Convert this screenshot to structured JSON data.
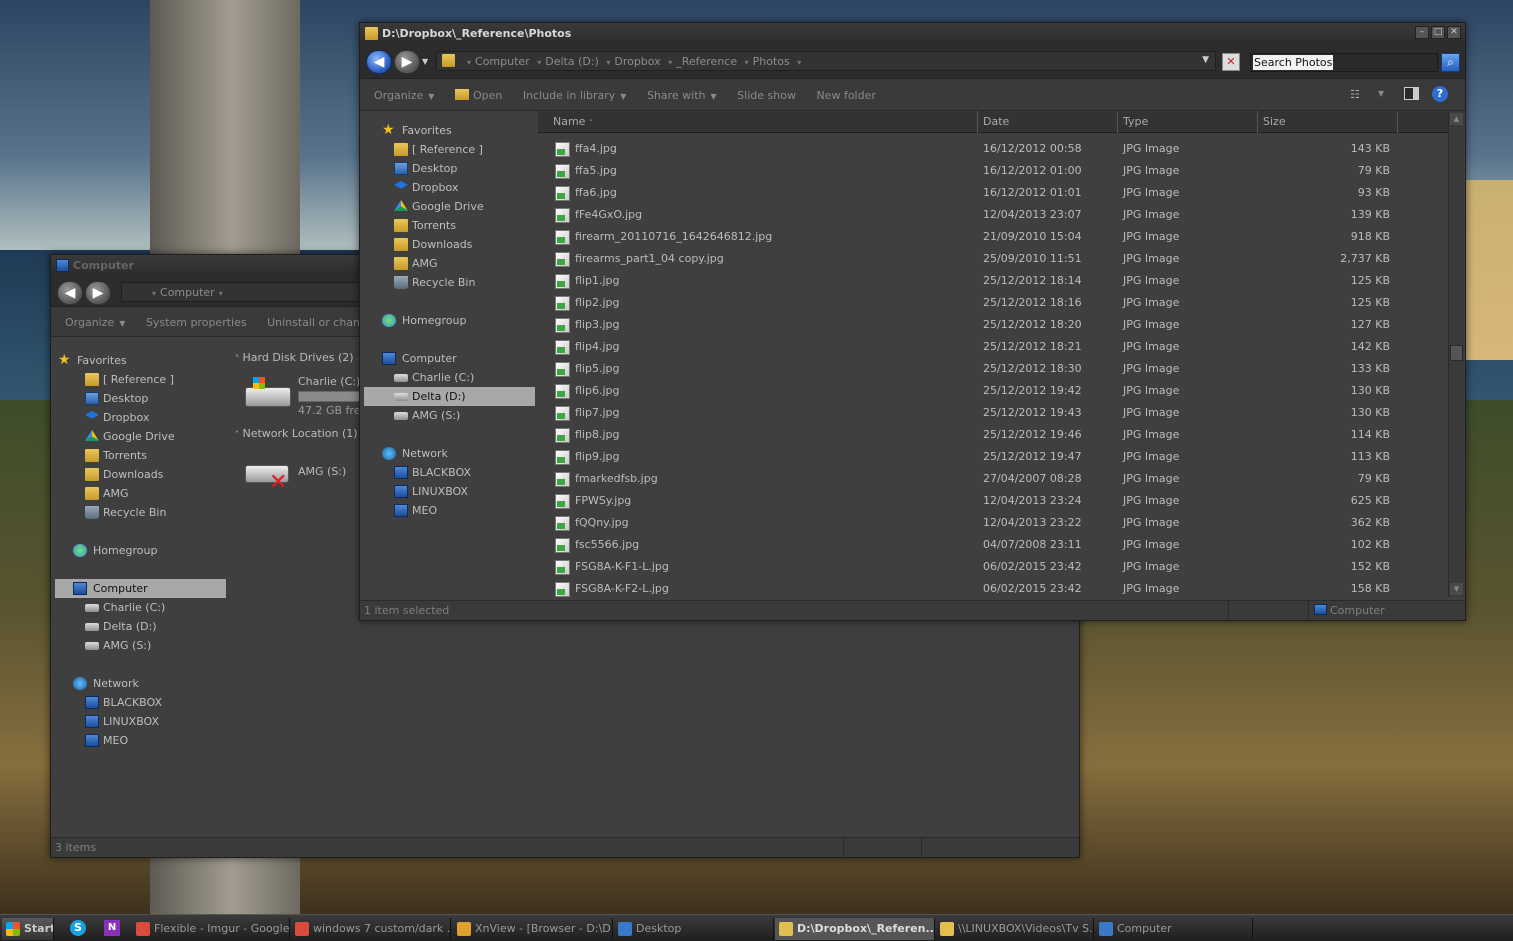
{
  "left_window": {
    "title": "Computer",
    "address": [
      "Computer"
    ],
    "toolbar": [
      "Organize",
      "System properties",
      "Uninstall or change a p"
    ],
    "nav": {
      "favorites": "Favorites",
      "fav_items": [
        "[ Reference ]",
        "Desktop",
        "Dropbox",
        "Google Drive",
        "Torrents",
        "Downloads",
        "AMG",
        "Recycle Bin"
      ],
      "homegroup": "Homegroup",
      "computer": "Computer",
      "drives": [
        "Charlie (C:)",
        "Delta (D:)",
        "AMG (S:)"
      ],
      "network": "Network",
      "net_items": [
        "BLACKBOX",
        "LINUXBOX",
        "MEO"
      ]
    },
    "groups": {
      "hdd": "Hard Disk Drives (2)",
      "netloc": "Network Location (1)"
    },
    "drive_charlie": {
      "name": "Charlie (C:)",
      "free": "47.2 GB free",
      "fill": 0.0
    },
    "drive_amg": {
      "name": "AMG (S:)"
    },
    "status": "3 items"
  },
  "right_window": {
    "title": "D:\\Dropbox\\_Reference\\Photos",
    "breadcrumb": [
      "Computer",
      "Delta (D:)",
      "Dropbox",
      "_Reference",
      "Photos"
    ],
    "search_placeholder": "Search Photos",
    "toolbar": {
      "organize": "Organize",
      "open": "Open",
      "include": "Include in library",
      "share": "Share with",
      "slideshow": "Slide show",
      "newfolder": "New folder"
    },
    "nav": {
      "favorites": "Favorites",
      "fav_items": [
        "[ Reference ]",
        "Desktop",
        "Dropbox",
        "Google Drive",
        "Torrents",
        "Downloads",
        "AMG",
        "Recycle Bin"
      ],
      "homegroup": "Homegroup",
      "computer": "Computer",
      "drives": [
        "Charlie (C:)",
        "Delta (D:)",
        "AMG (S:)"
      ],
      "network": "Network",
      "net_items": [
        "BLACKBOX",
        "LINUXBOX",
        "MEO"
      ]
    },
    "columns": [
      "Name",
      "Date",
      "Type",
      "Size"
    ],
    "files": [
      {
        "name": "ffa4.jpg",
        "date": "16/12/2012 00:58",
        "type": "JPG Image",
        "size": "143 KB"
      },
      {
        "name": "ffa5.jpg",
        "date": "16/12/2012 01:00",
        "type": "JPG Image",
        "size": "79 KB"
      },
      {
        "name": "ffa6.jpg",
        "date": "16/12/2012 01:01",
        "type": "JPG Image",
        "size": "93 KB"
      },
      {
        "name": "fFe4GxO.jpg",
        "date": "12/04/2013 23:07",
        "type": "JPG Image",
        "size": "139 KB"
      },
      {
        "name": "firearm_20110716_1642646812.jpg",
        "date": "21/09/2010 15:04",
        "type": "JPG Image",
        "size": "918 KB"
      },
      {
        "name": "firearms_part1_04 copy.jpg",
        "date": "25/09/2010 11:51",
        "type": "JPG Image",
        "size": "2,737 KB"
      },
      {
        "name": "flip1.jpg",
        "date": "25/12/2012 18:14",
        "type": "JPG Image",
        "size": "125 KB"
      },
      {
        "name": "flip2.jpg",
        "date": "25/12/2012 18:16",
        "type": "JPG Image",
        "size": "125 KB"
      },
      {
        "name": "flip3.jpg",
        "date": "25/12/2012 18:20",
        "type": "JPG Image",
        "size": "127 KB"
      },
      {
        "name": "flip4.jpg",
        "date": "25/12/2012 18:21",
        "type": "JPG Image",
        "size": "142 KB"
      },
      {
        "name": "flip5.jpg",
        "date": "25/12/2012 18:30",
        "type": "JPG Image",
        "size": "133 KB"
      },
      {
        "name": "flip6.jpg",
        "date": "25/12/2012 19:42",
        "type": "JPG Image",
        "size": "130 KB"
      },
      {
        "name": "flip7.jpg",
        "date": "25/12/2012 19:43",
        "type": "JPG Image",
        "size": "130 KB"
      },
      {
        "name": "flip8.jpg",
        "date": "25/12/2012 19:46",
        "type": "JPG Image",
        "size": "114 KB"
      },
      {
        "name": "flip9.jpg",
        "date": "25/12/2012 19:47",
        "type": "JPG Image",
        "size": "113 KB"
      },
      {
        "name": "fmarkedfsb.jpg",
        "date": "27/04/2007 08:28",
        "type": "JPG Image",
        "size": "79 KB"
      },
      {
        "name": "FPWSy.jpg",
        "date": "12/04/2013 23:24",
        "type": "JPG Image",
        "size": "625 KB"
      },
      {
        "name": "fQQny.jpg",
        "date": "12/04/2013 23:22",
        "type": "JPG Image",
        "size": "362 KB"
      },
      {
        "name": "fsc5566.jpg",
        "date": "04/07/2008 23:11",
        "type": "JPG Image",
        "size": "102 KB"
      },
      {
        "name": "FSG8A-K-F1-L.jpg",
        "date": "06/02/2015 23:42",
        "type": "JPG Image",
        "size": "152 KB"
      },
      {
        "name": "FSG8A-K-F2-L.jpg",
        "date": "06/02/2015 23:42",
        "type": "JPG Image",
        "size": "158 KB"
      }
    ],
    "status_left": "1 item selected",
    "status_right": "Computer"
  },
  "taskbar": {
    "start": "Start",
    "items": [
      {
        "label": "Flexible - Imgur - Google ...",
        "color": "#d94b3b"
      },
      {
        "label": "windows 7 custom/dark ...",
        "color": "#d94b3b"
      },
      {
        "label": "XnView - [Browser - D:\\D...",
        "color": "#e0a030"
      },
      {
        "label": "Desktop",
        "color": "#3a78c8"
      },
      {
        "label": "D:\\Dropbox\\_Referen...",
        "color": "#e2c050"
      },
      {
        "label": "\\\\LINUXBOX\\Videos\\Tv S...",
        "color": "#e2c050"
      },
      {
        "label": "Computer",
        "color": "#3a78c8"
      }
    ]
  }
}
